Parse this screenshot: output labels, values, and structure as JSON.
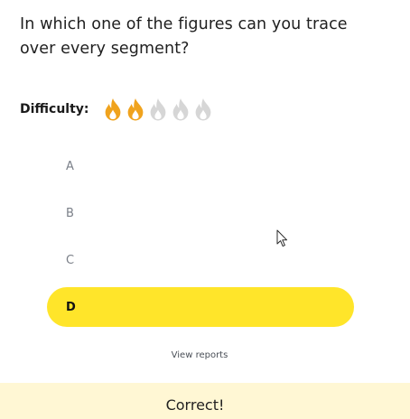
{
  "question": {
    "text": "In which one of the figures can you trace over every segment?"
  },
  "difficulty": {
    "label": "Difficulty:",
    "rating": 2,
    "max": 5,
    "active_color": "#f0a31d",
    "inactive_color": "#d6d6d6",
    "icon": "flame-icon"
  },
  "options": [
    {
      "label": "A",
      "selected": false
    },
    {
      "label": "B",
      "selected": false
    },
    {
      "label": "C",
      "selected": false
    },
    {
      "label": "D",
      "selected": true
    }
  ],
  "selected_color": "#ffe52a",
  "view_reports": "View reports",
  "feedback": {
    "text": "Correct!",
    "background": "#fff7d4"
  }
}
